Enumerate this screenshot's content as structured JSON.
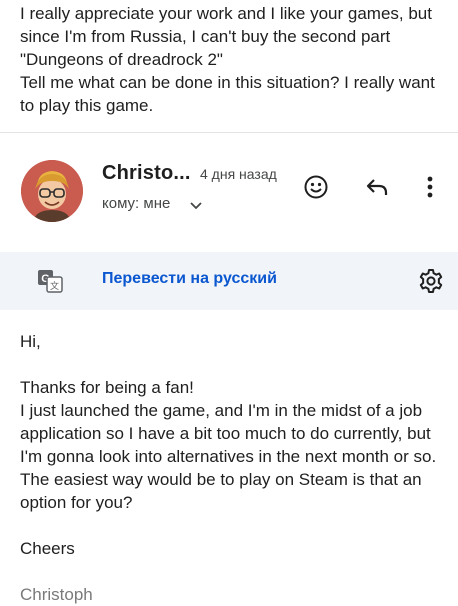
{
  "previous_message": {
    "lines": [
      "I really appreciate your work and I like your games, but since I'm from Russia, I can't buy the second part \"Dungeons of dreadrock 2\"",
      "Tell me what can be done in this situation? I really want to play this game."
    ]
  },
  "sender": {
    "name": "Christo...",
    "time": "4 дня назад",
    "recipient_label": "кому: мне"
  },
  "translate": {
    "link_label": "Перевести на русский"
  },
  "message": {
    "greeting": "Hi,",
    "paragraph_lines": [
      "Thanks for being a fan!",
      "I just launched the game, and I'm in the midst of a job application so I have a bit too much to do currently, but I'm gonna look into alternatives in the next month or so.",
      "The easiest way would be to play on Steam is that an option for you?"
    ],
    "closing": "Cheers",
    "signature": "Christoph"
  },
  "icons": {
    "emoji": "smiley-icon",
    "reply": "reply-icon",
    "more": "more-vert-icon",
    "translate": "google-translate-icon",
    "settings": "gear-icon",
    "expand": "chevron-down-icon"
  },
  "colors": {
    "link": "#0b57d0",
    "translate_bar_bg": "#f1f4f9",
    "signature": "#7a7a7a"
  }
}
